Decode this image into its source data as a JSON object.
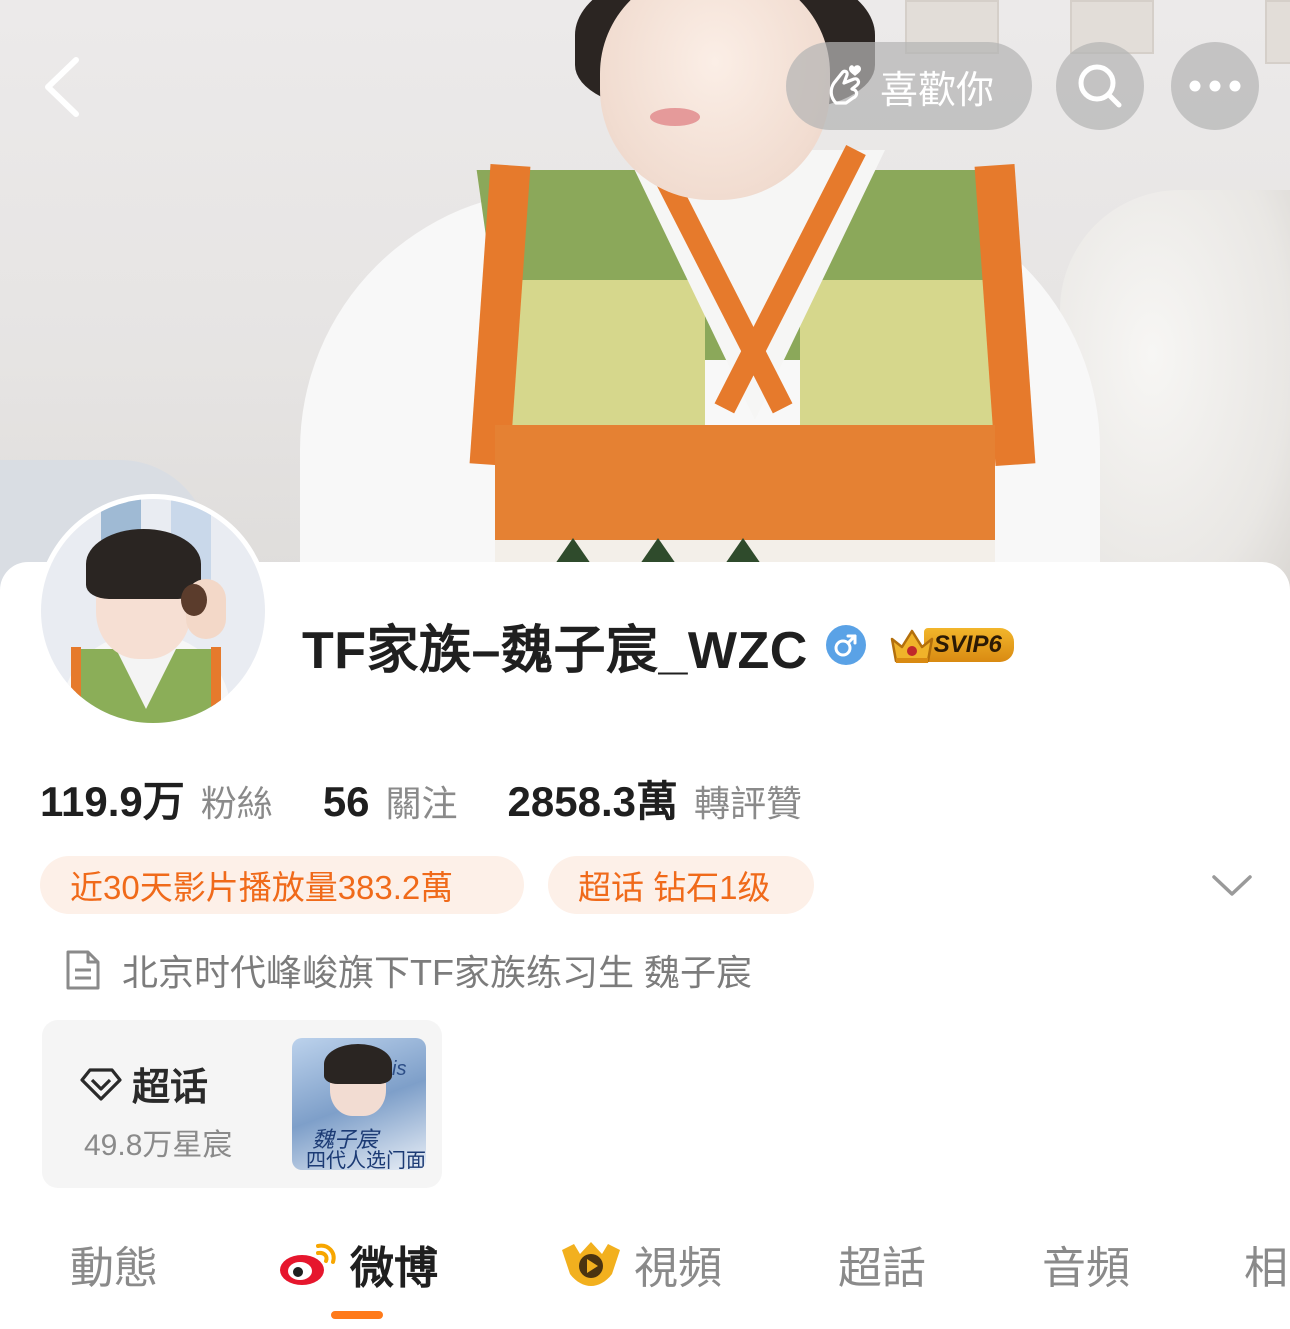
{
  "nav": {
    "like_label": "喜歡你",
    "back_icon": "back-arrow-icon",
    "search_icon": "search-icon",
    "more_icon": "more-icon"
  },
  "profile": {
    "name": "TF家族–魏子宸_WZC",
    "gender_icon": "male-icon",
    "vip_badge": "SVIP6"
  },
  "stats": [
    {
      "value": "119.9万",
      "label": "粉絲"
    },
    {
      "value": "56",
      "label": "關注"
    },
    {
      "value": "2858.3萬",
      "label": "轉評贊"
    }
  ],
  "tags": [
    {
      "text": "近30天影片播放量383.2萬"
    },
    {
      "text": "超话 钻石1级"
    }
  ],
  "bio": "北京时代峰峻旗下TF家族练习生 魏子宸",
  "chaohua": {
    "title": "超话",
    "count": "49.8万星宸",
    "thumb_text1": "魏子宸",
    "thumb_text2": "四代人选门面",
    "thumb_text3": "is"
  },
  "tabs": [
    {
      "label": "動態"
    },
    {
      "label": "微博"
    },
    {
      "label": "視頻"
    },
    {
      "label": "超話"
    },
    {
      "label": "音頻"
    },
    {
      "label": "相"
    }
  ],
  "active_tab": "微博",
  "colors": {
    "accent": "#ff7a1a",
    "tag_text": "#f06a1a",
    "tag_bg": "#fdf0e8",
    "gender_blue": "#5aa2e6",
    "vip_gold": "#e9a21f"
  }
}
